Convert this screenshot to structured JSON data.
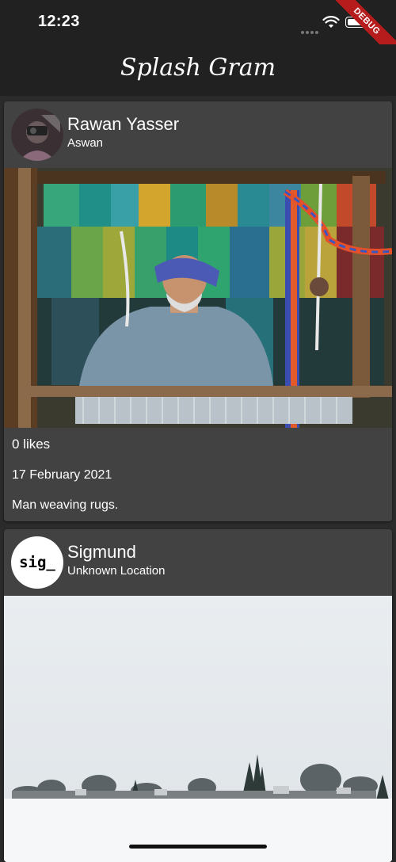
{
  "status_bar": {
    "time": "12:23",
    "debug_label": "DEBUG"
  },
  "app": {
    "title": "Splash Gram"
  },
  "posts": [
    {
      "user_name": "Rawan Yasser",
      "location": "Aswan",
      "likes": "0 likes",
      "date": "17 February 2021",
      "caption": "Man weaving rugs."
    },
    {
      "user_name": "Sigmund",
      "location": "Unknown Location",
      "avatar_text": "sig_"
    }
  ]
}
